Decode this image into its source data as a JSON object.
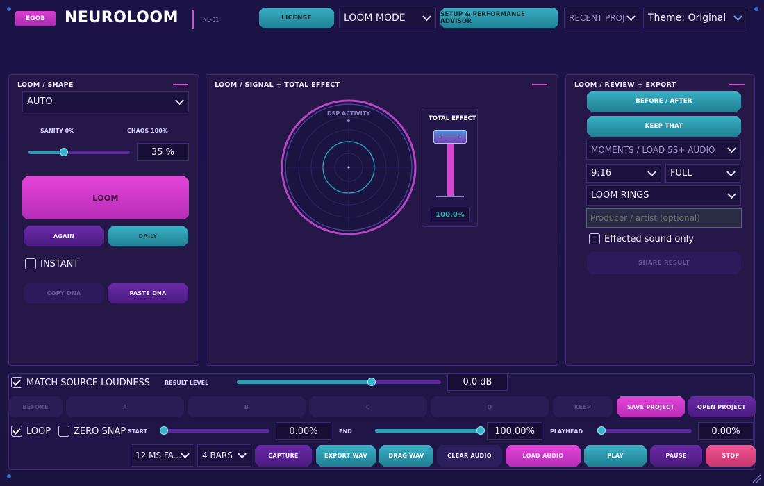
{
  "header": {
    "logo_badge": "EGOB",
    "app_title": "NEUROLOOM",
    "version": "NL-01",
    "license_btn": "LICENSE",
    "mode_select": "LOOM MODE",
    "advisor_btn": "SETUP & PERFORMANCE ADVISOR",
    "recent_select": "RECENT PROJ...",
    "theme_select": "Theme: Original"
  },
  "shape_panel": {
    "title": "LOOM  /  SHAPE",
    "shape_select": "AUTO",
    "sanity_label": "SANITY 0%",
    "chaos_label": "CHAOS 100%",
    "chaos_value": "35 %",
    "chaos_fraction": 0.35,
    "loom_btn": "LOOM",
    "again_btn": "AGAIN",
    "daily_btn": "DAILY",
    "instant_label": "INSTANT",
    "copy_dna_btn": "COPY DNA",
    "paste_dna_btn": "PASTE DNA"
  },
  "signal_panel": {
    "title": "LOOM  /  SIGNAL + TOTAL EFFECT",
    "dsp_label": "DSP ACTIVITY",
    "total_effect_label": "TOTAL EFFECT",
    "total_effect_value": "100.0%",
    "total_effect_fraction": 1.0
  },
  "review_panel": {
    "title": "LOOM  /  REVIEW + EXPORT",
    "before_after_btn": "BEFORE / AFTER",
    "keep_that_btn": "KEEP THAT",
    "moments_select": "MOMENTS / LOAD 5S+ AUDIO",
    "ratio_select": "9:16",
    "size_select": "FULL",
    "visual_select": "LOOM RINGS",
    "producer_placeholder": "Producer / artist (optional)",
    "effected_label": "Effected sound only",
    "share_btn": "SHARE RESULT"
  },
  "bottom": {
    "match_label": "MATCH SOURCE LOUDNESS",
    "result_level_label": "RESULT LEVEL",
    "result_level_value": "0.0 dB",
    "result_level_fraction": 0.66,
    "slots": [
      "BEFORE",
      "A",
      "B",
      "C",
      "D",
      "KEEP"
    ],
    "save_project_btn": "SAVE PROJECT",
    "open_project_btn": "OPEN PROJECT",
    "loop_label": "LOOP",
    "zero_snap_label": "ZERO SNAP",
    "start_label": "START",
    "start_value": "0.00%",
    "start_fraction": 0.0,
    "end_label": "END",
    "end_value": "100.00%",
    "end_fraction": 1.0,
    "playhead_label": "PLAYHEAD",
    "playhead_value": "0.00%",
    "playhead_fraction": 0.0,
    "fade_select": "12 MS FA...",
    "bars_select": "4 BARS",
    "capture_btn": "CAPTURE",
    "export_wav_btn": "EXPORT WAV",
    "drag_wav_btn": "DRAG WAV",
    "clear_audio_btn": "CLEAR AUDIO",
    "load_audio_btn": "LOAD AUDIO",
    "play_btn": "PLAY",
    "pause_btn": "PAUSE",
    "stop_btn": "STOP"
  }
}
